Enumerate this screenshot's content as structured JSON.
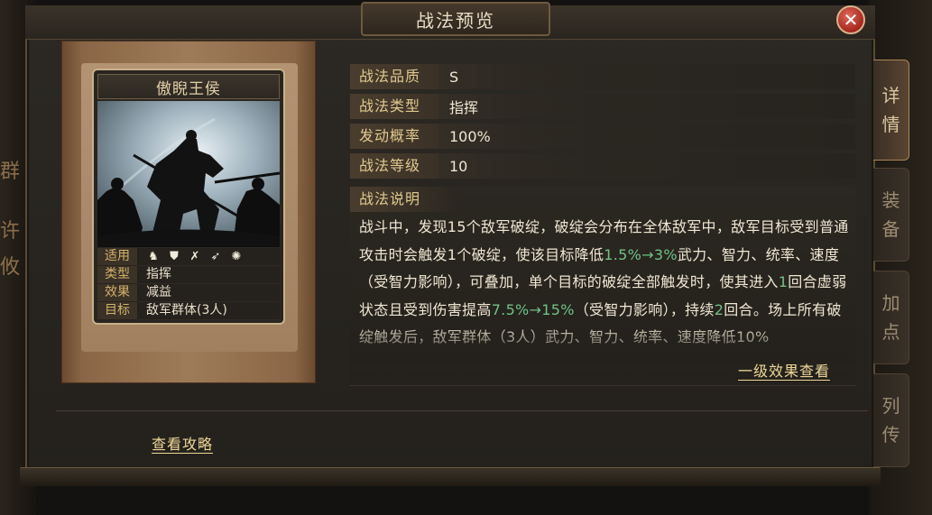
{
  "title": "战法预览",
  "close_icon": "close-icon",
  "side_tabs": [
    {
      "label": "详\n情",
      "active": true
    },
    {
      "label": "装\n备",
      "active": false
    },
    {
      "label": "加\n点",
      "active": false
    },
    {
      "label": "列\n传",
      "active": false
    }
  ],
  "left_edge": [
    "群",
    "许",
    "攸"
  ],
  "card": {
    "name": "傲睨王侯",
    "rows": [
      {
        "key": "适用",
        "value": "",
        "icons": [
          "cavalry-icon",
          "shield-icon",
          "bow-icon",
          "spear-icon",
          "siege-icon"
        ]
      },
      {
        "key": "类型",
        "value": "指挥"
      },
      {
        "key": "效果",
        "value": "减益"
      },
      {
        "key": "目标",
        "value": "敌军群体(3人)"
      }
    ]
  },
  "attributes": [
    {
      "key": "战法品质",
      "value": "S"
    },
    {
      "key": "战法类型",
      "value": "指挥"
    },
    {
      "key": "发动概率",
      "value": "100%"
    },
    {
      "key": "战法等级",
      "value": "10"
    }
  ],
  "description": {
    "label": "战法说明",
    "segments": [
      {
        "t": "战斗中，发现15个敌军破绽，破绽会分布在全体敌军中，敌军目标受到普通攻击时会触发1个破绽，使该目标降低",
        "g": false
      },
      {
        "t": "1.5%→3%",
        "g": true
      },
      {
        "t": "武力、智力、统率、速度（受智力影响），可叠加，单个目标的破绽全部触发时，使其进入",
        "g": false
      },
      {
        "t": "1",
        "g": true
      },
      {
        "t": "回合虚弱状态且受到伤害提高",
        "g": false
      },
      {
        "t": "7.5%→15%",
        "g": true
      },
      {
        "t": "（受智力影响），持续",
        "g": false
      },
      {
        "t": "2",
        "g": true
      },
      {
        "t": "回合。场上所有破绽触发后，敌军群体（3人）武力、智力、统率、速度降低10%",
        "g": false
      }
    ],
    "effect_link": "一级效果查看"
  },
  "guide_link": "查看攻略",
  "colors": {
    "highlight_green": "#6fc286",
    "gold": "#e0c98e",
    "close_red": "#a5261d"
  }
}
